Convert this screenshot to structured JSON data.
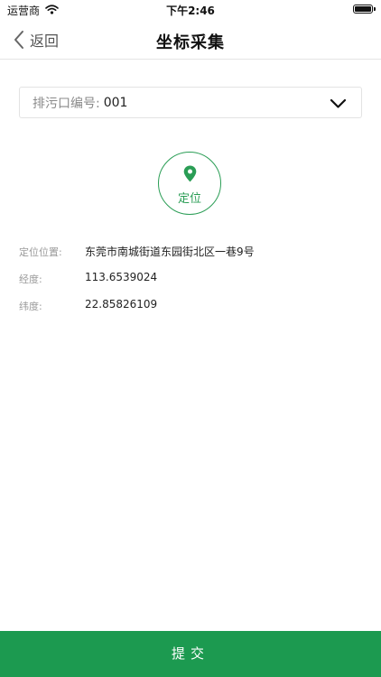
{
  "status_bar": {
    "carrier": "运营商",
    "time": "下午2:46",
    "battery_level": 1.0
  },
  "nav": {
    "back_label": "返回",
    "title": "坐标采集"
  },
  "outlet_select": {
    "label": "排污口编号:",
    "value": "001"
  },
  "locate": {
    "label": "定位"
  },
  "info": {
    "address_label": "定位位置:",
    "address_value": "东莞市南城街道东园街北区一巷9号",
    "longitude_label": "经度:",
    "longitude_value": "113.6539024",
    "latitude_label": "纬度:",
    "latitude_value": "22.85826109"
  },
  "submit": {
    "label": "提交"
  },
  "colors": {
    "accent": "#1c9a50",
    "locate_green": "#2a9d55"
  }
}
